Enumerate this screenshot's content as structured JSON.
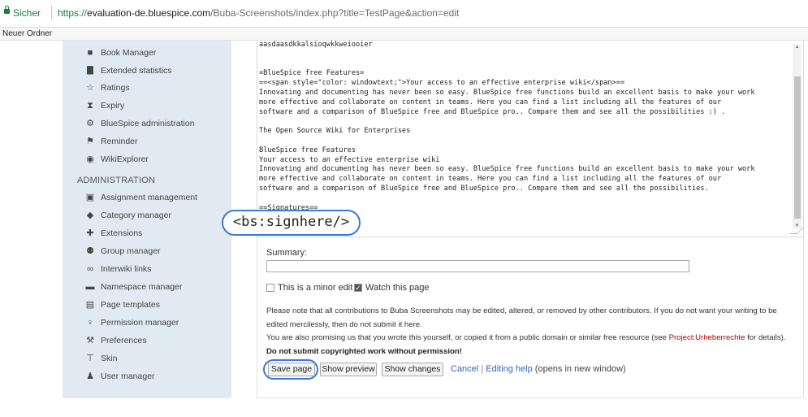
{
  "browser": {
    "secure_label": "Sicher",
    "url_protocol": "https://",
    "url_host": "evaluation-de.bluespice.com",
    "url_path": "/Buba-Screenshots/index.php?title=TestPage&action=edit"
  },
  "bookmarks": {
    "folder": "Neuer Ordner"
  },
  "sidebar": {
    "tools": [
      {
        "label": "Book Manager",
        "icon": "book-icon"
      },
      {
        "label": "Extended statistics",
        "icon": "chart-icon"
      },
      {
        "label": "Ratings",
        "icon": "star-icon"
      },
      {
        "label": "Expiry",
        "icon": "hourglass-icon"
      },
      {
        "label": "BlueSpice administration",
        "icon": "gear-icon"
      },
      {
        "label": "Reminder",
        "icon": "flag-icon"
      },
      {
        "label": "WikiExplorer",
        "icon": "compass-icon"
      }
    ],
    "admin_heading": "ADMINISTRATION",
    "admin": [
      {
        "label": "Assignment management",
        "icon": "id-card-icon"
      },
      {
        "label": "Category manager",
        "icon": "tag-icon"
      },
      {
        "label": "Extensions",
        "icon": "puzzle-icon"
      },
      {
        "label": "Group manager",
        "icon": "group-icon"
      },
      {
        "label": "Interwiki links",
        "icon": "link-icon"
      },
      {
        "label": "Namespace manager",
        "icon": "inbox-icon"
      },
      {
        "label": "Page templates",
        "icon": "clipboard-icon"
      },
      {
        "label": "Permission manager",
        "icon": "key-icon"
      },
      {
        "label": "Preferences",
        "icon": "wrench-icon"
      },
      {
        "label": "Skin",
        "icon": "paint-roller-icon"
      },
      {
        "label": "User manager",
        "icon": "user-cog-icon"
      }
    ]
  },
  "editor": {
    "content": "aasdaasdkkalsioqwkkweiooier\n\n\n=BlueSpice free Features=\n==<span style=\"color: windowtext;\">Your access to an effective enterprise wiki</span>==\nInnovating and documenting has never been so easy. BlueSpice free functions build an excellent basis to make your work\nmore effective and collaborate on content in teams. Here you can find a list including all the features of our\nsoftware and a comparison of BlueSpice free and BlueSpice pro.. Compare them and see all the possibilities :) .\n\nThe Open Source Wiki for Enterprises\n\nBlueSpice free Features\nYour access to an effective enterprise wiki\nInnovating and documenting has never been so easy. BlueSpice free functions build an excellent basis to make your work\nmore effective and collaborate on content in teams. Here you can find a list including all the features of our\nsoftware and a comparison of BlueSpice free and BlueSpice pro.. Compare them and see all the possibilities.\n\n==Signatures=="
  },
  "callout": {
    "text": "<bs:signhere/>"
  },
  "form": {
    "summary_label": "Summary:",
    "summary_value": "",
    "minor_edit_label": "This is a minor edit",
    "minor_edit_checked": false,
    "watch_label": "Watch this page",
    "watch_checked": true,
    "note1": "Please note that all contributions to Buba Screenshots may be edited, altered, or removed by other contributors. If you do not want your writing to be",
    "note2": "edited mercilessly, then do not submit it here.",
    "note3_pre": "You are also promising us that you wrote this yourself, or copied it from a public domain or similar free resource (see ",
    "note3_link": "Project:Urheberrechte",
    "note3_post": " for details).",
    "note4": "Do not submit copyrighted work without permission!",
    "save_button": "Save page",
    "preview_button": "Show preview",
    "changes_button": "Show changes",
    "cancel_link": "Cancel",
    "separator": "|",
    "help_link": "Editing help",
    "help_suffix": " (opens in new window)"
  }
}
